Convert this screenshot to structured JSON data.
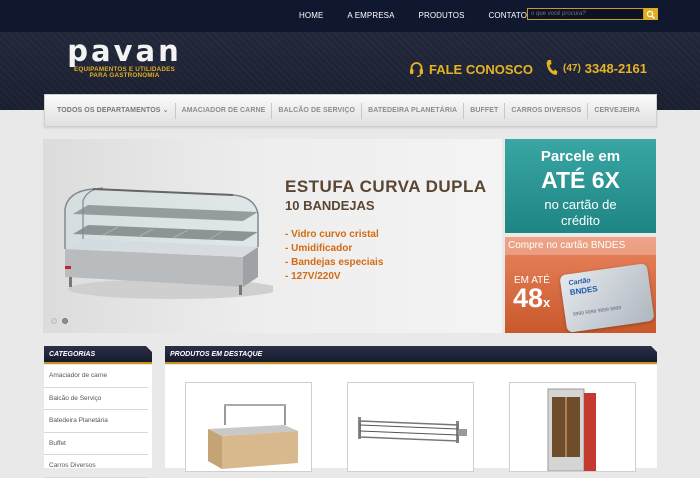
{
  "top_nav": {
    "items": [
      "HOME",
      "A EMPRESA",
      "PRODUTOS",
      "CONTATO"
    ],
    "search_placeholder": "o que você procura?"
  },
  "logo": {
    "name": "pavan",
    "tagline_1": "EQUIPAMENTOS E UTILIDADES",
    "tagline_2": "PARA GASTRONOMIA"
  },
  "contact": {
    "fale_label": "FALE CONOSCO",
    "phone_area": "(47)",
    "phone_number": "3348-2161"
  },
  "departments": [
    "TODOS OS DEPARTAMENTOS",
    "AMACIADOR DE CARNE",
    "BALCÃO DE SERVIÇO",
    "BATEDEIRA PLANETÁRIA",
    "BUFFET",
    "CARROS DIVERSOS",
    "CERVEJEIRA"
  ],
  "main_banner": {
    "title_1": "ESTUFA CURVA DUPLA",
    "title_2": "10 BANDEJAS",
    "features": [
      "- Vidro curvo cristal",
      "- Umidificador",
      "- Bandejas especiais",
      "- 127V/220V"
    ],
    "slides": 2,
    "active_slide": 1
  },
  "side_banner_1": {
    "line_1": "Parcele em",
    "line_2": "ATÉ 6X",
    "line_3": "no cartão de",
    "line_4": "crédito"
  },
  "side_banner_2": {
    "title": "Compre no cartão BNDES",
    "em_ate": "EM ATÉ",
    "installments": "48",
    "x": "x",
    "card_label_1": "Cartão",
    "card_label_2": "BNDES",
    "card_number": "9999 9999 9999 9999"
  },
  "categories": {
    "title": "CATEGORIAS",
    "items": [
      "Amaciador de carne",
      "Balcão de Serviço",
      "Batedeira Planetária",
      "Buffet",
      "Carros Diversos"
    ]
  },
  "featured": {
    "title": "PRODUTOS EM DESTAQUE",
    "products": [
      {
        "name": "buffet-counter"
      },
      {
        "name": "rotisserie-spit"
      },
      {
        "name": "vertical-rotisserie-oven"
      }
    ]
  },
  "colors": {
    "navy": "#1a1f30",
    "gold": "#e6b325",
    "teal": "#2a9997",
    "orange": "#d9693d"
  }
}
